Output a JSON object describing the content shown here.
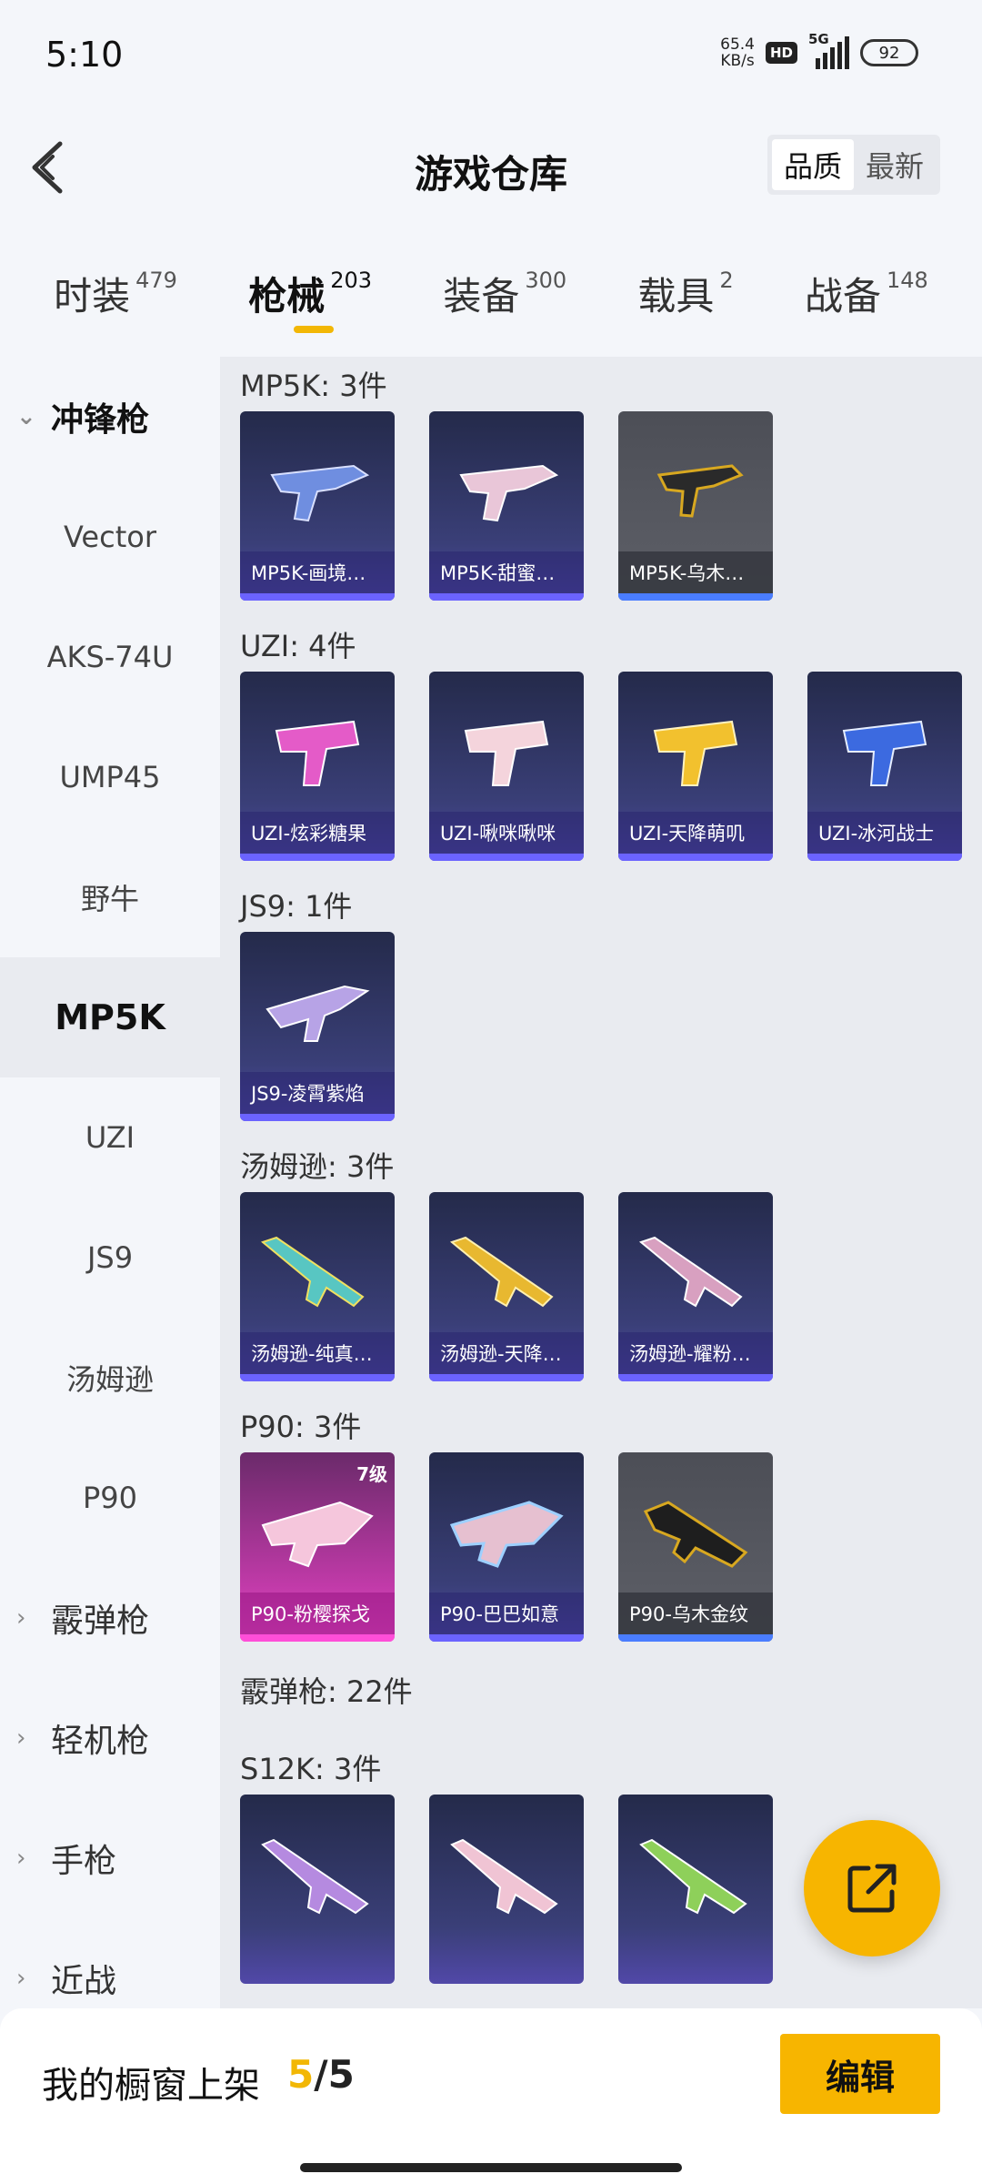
{
  "status_bar": {
    "time": "5:10",
    "net_speed_value": "65.4",
    "net_speed_unit": "KB/s",
    "hd": "HD",
    "network": "5G",
    "battery": "92"
  },
  "header": {
    "title": "游戏仓库",
    "sort_quality": "品质",
    "sort_latest": "最新"
  },
  "tabs": [
    {
      "label": "时装",
      "count": "479"
    },
    {
      "label": "枪械",
      "count": "203"
    },
    {
      "label": "装备",
      "count": "300"
    },
    {
      "label": "载具",
      "count": "2"
    },
    {
      "label": "战备",
      "count": "148"
    }
  ],
  "sidebar": {
    "items": [
      {
        "label": "冲锋枪",
        "chevron": "⌄"
      },
      {
        "label": "Vector"
      },
      {
        "label": "AKS-74U"
      },
      {
        "label": "UMP45"
      },
      {
        "label": "野牛"
      },
      {
        "label": "MP5K"
      },
      {
        "label": "UZI"
      },
      {
        "label": "JS9"
      },
      {
        "label": "汤姆逊"
      },
      {
        "label": "P90"
      },
      {
        "label": "霰弹枪",
        "chevron": "›"
      },
      {
        "label": "轻机枪",
        "chevron": "›"
      },
      {
        "label": "手枪",
        "chevron": "›"
      },
      {
        "label": "近战",
        "chevron": "›"
      }
    ]
  },
  "groups": [
    {
      "title": "MP5K: 3件",
      "items": [
        "MP5K-画境…",
        "MP5K-甜蜜…",
        "MP5K-乌木…"
      ]
    },
    {
      "title": "UZI: 4件",
      "items": [
        "UZI-炫彩糖果",
        "UZI-啾咪啾咪",
        "UZI-天降萌叽",
        "UZI-冰河战士"
      ]
    },
    {
      "title": "JS9: 1件",
      "items": [
        "JS9-凌霄紫焰"
      ]
    },
    {
      "title": "汤姆逊: 3件",
      "items": [
        "汤姆逊-纯真…",
        "汤姆逊-天降…",
        "汤姆逊-耀粉…"
      ]
    },
    {
      "title": "P90: 3件",
      "items": [
        "P90-粉樱探戈",
        "P90-巴巴如意",
        "P90-乌木金纹"
      ],
      "level_badge": "7级"
    },
    {
      "title": "霰弹枪: 22件"
    },
    {
      "title": "S12K: 3件"
    }
  ],
  "bottom_bar": {
    "label": "我的橱窗上架",
    "count_current": "5",
    "count_sep": "/",
    "count_total": "5",
    "edit_label": "编辑"
  },
  "colors": {
    "accent": "#f7b500",
    "card_purple": "#3a3f78",
    "card_grey": "#5e6068",
    "card_pink": "#c03aa8"
  }
}
